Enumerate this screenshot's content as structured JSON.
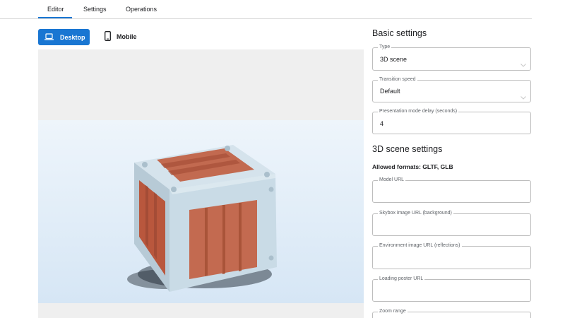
{
  "tabs": [
    {
      "label": "Editor",
      "active": true
    },
    {
      "label": "Settings",
      "active": false
    },
    {
      "label": "Operations",
      "active": false
    }
  ],
  "device_toggle": {
    "desktop_label": "Desktop",
    "mobile_label": "Mobile",
    "selected": "Desktop"
  },
  "basic_settings": {
    "title": "Basic settings",
    "type": {
      "label": "Type",
      "value": "3D scene"
    },
    "transition_speed": {
      "label": "Transition speed",
      "value": "Default"
    },
    "presentation_delay": {
      "label": "Presentation mode delay (seconds)",
      "value": "4"
    }
  },
  "scene_settings": {
    "title": "3D scene settings",
    "allowed_formats": "Allowed formats: GLTF, GLB",
    "model_url": {
      "label": "Model URL",
      "value": ""
    },
    "skybox_url": {
      "label": "Skybox image URL (background)",
      "value": ""
    },
    "environment_url": {
      "label": "Environment image URL (reflections)",
      "value": ""
    },
    "poster_url": {
      "label": "Loading poster URL",
      "value": ""
    },
    "zoom_range": {
      "label": "Zoom range",
      "value": ""
    }
  },
  "colors": {
    "accent": "#1976d2",
    "crate_frame": "#c9dbe6",
    "crate_panel": "#c0694f"
  }
}
